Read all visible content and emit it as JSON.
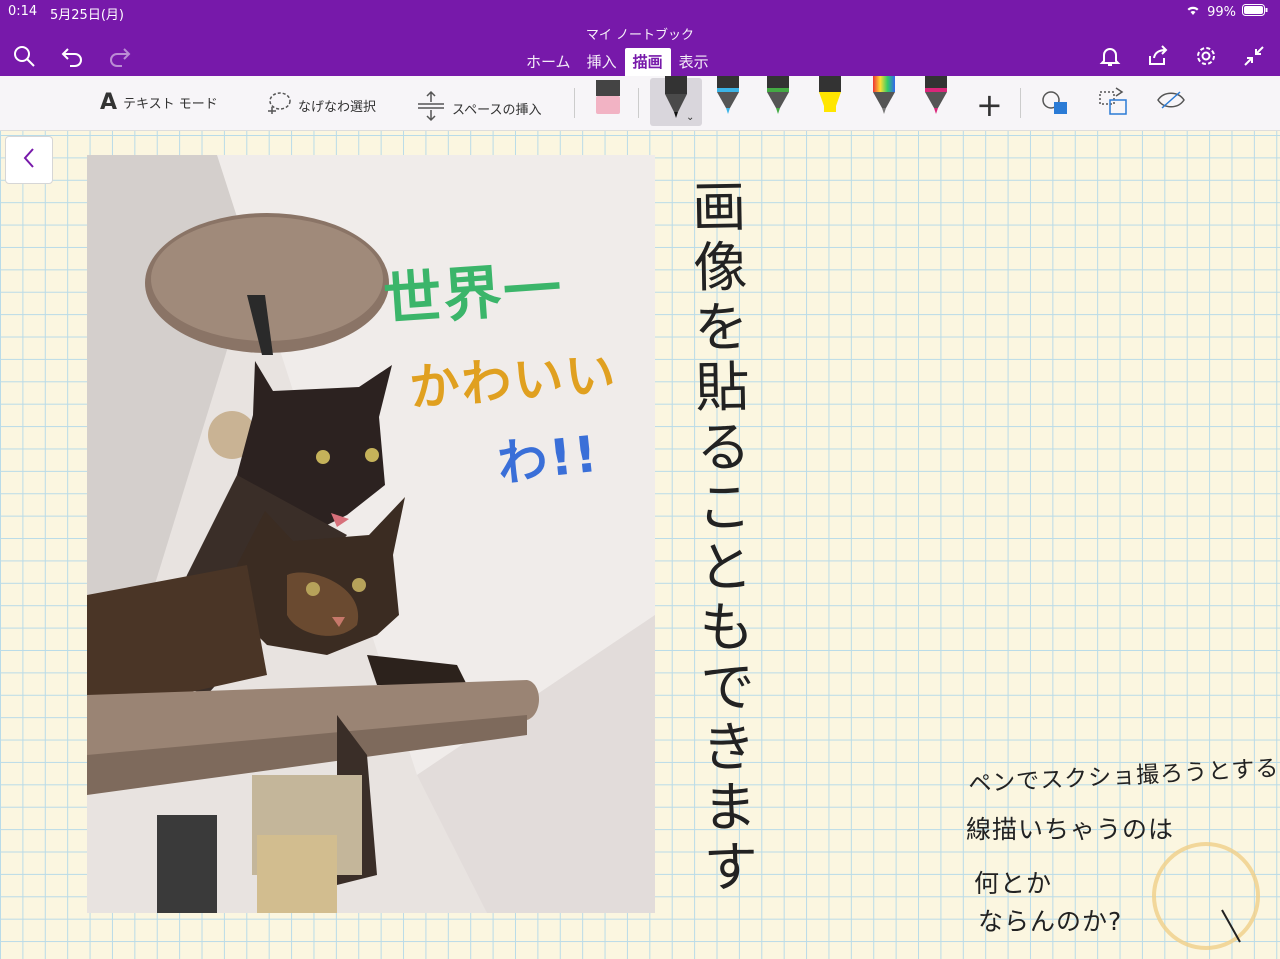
{
  "status": {
    "time": "0:14",
    "date": "5月25日(月)",
    "battery": "99%"
  },
  "notebook_title": "マイ ノートブック",
  "tabs": [
    {
      "label": "ホーム"
    },
    {
      "label": "挿入"
    },
    {
      "label": "描画"
    },
    {
      "label": "表示"
    }
  ],
  "toolbar": {
    "text_mode": "テキスト モード",
    "lasso": "なげなわ選択",
    "insert_space": "スペースの挿入"
  },
  "pens": [
    {
      "name": "eraser",
      "color": "#f2b3c4"
    },
    {
      "name": "pen-black",
      "color": "#222222"
    },
    {
      "name": "pen-blue",
      "color": "#3cb4e6"
    },
    {
      "name": "pen-green",
      "color": "#44aa44"
    },
    {
      "name": "highlighter-yellow",
      "color": "#ffe600"
    },
    {
      "name": "pen-rainbow",
      "color": "#888888"
    },
    {
      "name": "pen-magenta",
      "color": "#d9267a"
    }
  ],
  "colors": {
    "brand": "#7719aa",
    "paper": "#fbf6e0",
    "grid": "#b9dbe8"
  },
  "photo_overlay": [
    "世界一",
    "かわいい",
    "わ!!"
  ],
  "handwriting_vertical": [
    "画",
    "像",
    "を",
    "貼",
    "る",
    "こ",
    "と",
    "も",
    "で",
    "き",
    "ま",
    "す"
  ],
  "handwriting_note": [
    "ペンでスクショ撮ろうとすると",
    "線描いちゃうのは",
    "何とか",
    "ならんのか?"
  ]
}
